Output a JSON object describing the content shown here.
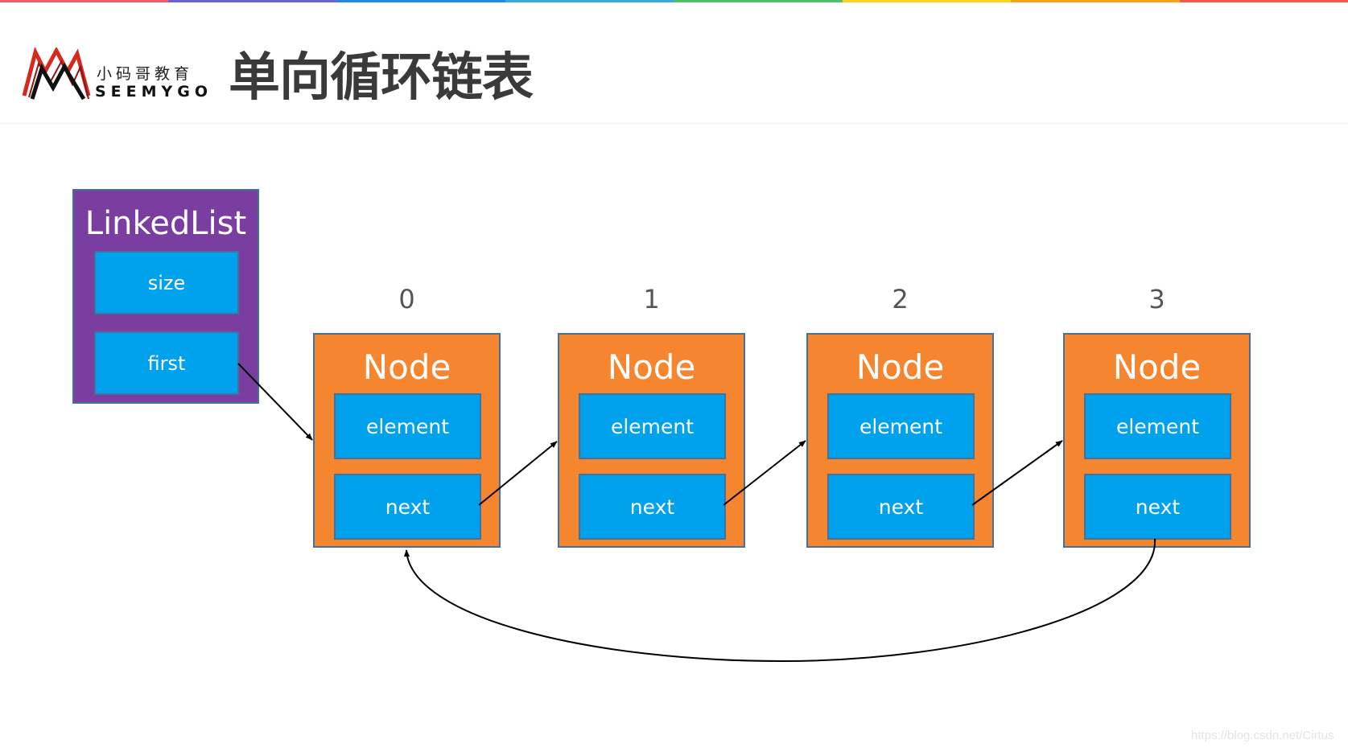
{
  "topbar_colors": [
    "#f25a68",
    "#6a63d6",
    "#1e88f0",
    "#3aa9e0",
    "#4fc06a",
    "#ffd21f",
    "#ff9f1a",
    "#f5574f"
  ],
  "logo": {
    "chinese": "小码哥教育",
    "english": "SEEMYGO",
    "icon": "mountain-m-logo-icon",
    "colors": {
      "outer": "#d8271c",
      "inner": "#111111"
    }
  },
  "title": "单向循环链表",
  "colors": {
    "linkedlist_fill": "#7a3da0",
    "node_fill": "#f68530",
    "field_fill": "#00a2ed",
    "border": "#41719c",
    "arrow": "#000000"
  },
  "linked_list": {
    "title": "LinkedList",
    "fields": [
      "size",
      "first"
    ]
  },
  "nodes": [
    {
      "index": "0",
      "title": "Node",
      "fields": [
        "element",
        "next"
      ]
    },
    {
      "index": "1",
      "title": "Node",
      "fields": [
        "element",
        "next"
      ]
    },
    {
      "index": "2",
      "title": "Node",
      "fields": [
        "element",
        "next"
      ]
    },
    {
      "index": "3",
      "title": "Node",
      "fields": [
        "element",
        "next"
      ]
    }
  ],
  "edges": [
    {
      "from": "LinkedList.first",
      "to": "Node 0"
    },
    {
      "from": "Node 0.next",
      "to": "Node 1"
    },
    {
      "from": "Node 1.next",
      "to": "Node 2"
    },
    {
      "from": "Node 2.next",
      "to": "Node 3"
    },
    {
      "from": "Node 3.next",
      "to": "Node 0",
      "style": "curved"
    }
  ],
  "watermark": "https://blog.csdn.net/Cirtus"
}
